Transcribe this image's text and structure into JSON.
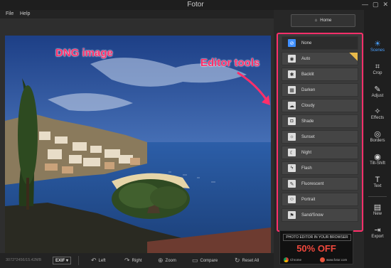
{
  "window": {
    "title": "Fotor",
    "minimize": "—",
    "maximize": "▢",
    "close": "✕"
  },
  "menu": [
    {
      "label": "File"
    },
    {
      "label": "Help"
    }
  ],
  "annotations": {
    "image_label": "DNG image",
    "tools_label": "Editor tools"
  },
  "status": {
    "info": "3072*2456/15.42MB",
    "exif": "EXIF ▾"
  },
  "bottom_tools": [
    {
      "label": "Left",
      "icon": "rotate-left-icon",
      "glyph": "↶"
    },
    {
      "label": "Right",
      "icon": "rotate-right-icon",
      "glyph": "↷"
    },
    {
      "label": "Zoom",
      "icon": "zoom-icon",
      "glyph": "⊕"
    },
    {
      "label": "Compare",
      "icon": "compare-icon",
      "glyph": "▭"
    },
    {
      "label": "Reset All",
      "icon": "reset-icon",
      "glyph": "↻"
    }
  ],
  "panel": {
    "home_label": "Home",
    "scenes": [
      {
        "label": "None",
        "glyph": "⊘",
        "selected": true
      },
      {
        "label": "Auto",
        "glyph": "◉"
      },
      {
        "label": "Backlit",
        "glyph": "✱"
      },
      {
        "label": "Darken",
        "glyph": "▦"
      },
      {
        "label": "Cloudy",
        "glyph": "☁"
      },
      {
        "label": "Shade",
        "glyph": "◘"
      },
      {
        "label": "Sunset",
        "glyph": "☼"
      },
      {
        "label": "Night",
        "glyph": "☾"
      },
      {
        "label": "Flash",
        "glyph": "ϟ"
      },
      {
        "label": "Fluorescent",
        "glyph": "✎"
      },
      {
        "label": "Portrait",
        "glyph": "☺"
      },
      {
        "label": "Sand/Snow",
        "glyph": "⚑"
      }
    ],
    "ad": {
      "headline": "PHOTO EDITOR IN YOUR BROWSER",
      "offer": "50% OFF",
      "browser": "Chrome",
      "site": "www.fotor.com"
    }
  },
  "tools": [
    {
      "label": "Scenes",
      "glyph": "☀",
      "active": true
    },
    {
      "label": "Crop",
      "glyph": "⌗"
    },
    {
      "label": "Adjust",
      "glyph": "✎"
    },
    {
      "label": "Effects",
      "glyph": "✧"
    },
    {
      "label": "Borders",
      "glyph": "◎"
    },
    {
      "label": "Tilt-Shift",
      "glyph": "◉"
    },
    {
      "label": "Text",
      "glyph": "T"
    },
    {
      "label": "New",
      "glyph": "▤"
    },
    {
      "label": "Export",
      "glyph": "⇥"
    }
  ],
  "colors": {
    "accent": "#ff2f6a",
    "highlight": "#4aa0ff",
    "offer": "#f0483d"
  }
}
